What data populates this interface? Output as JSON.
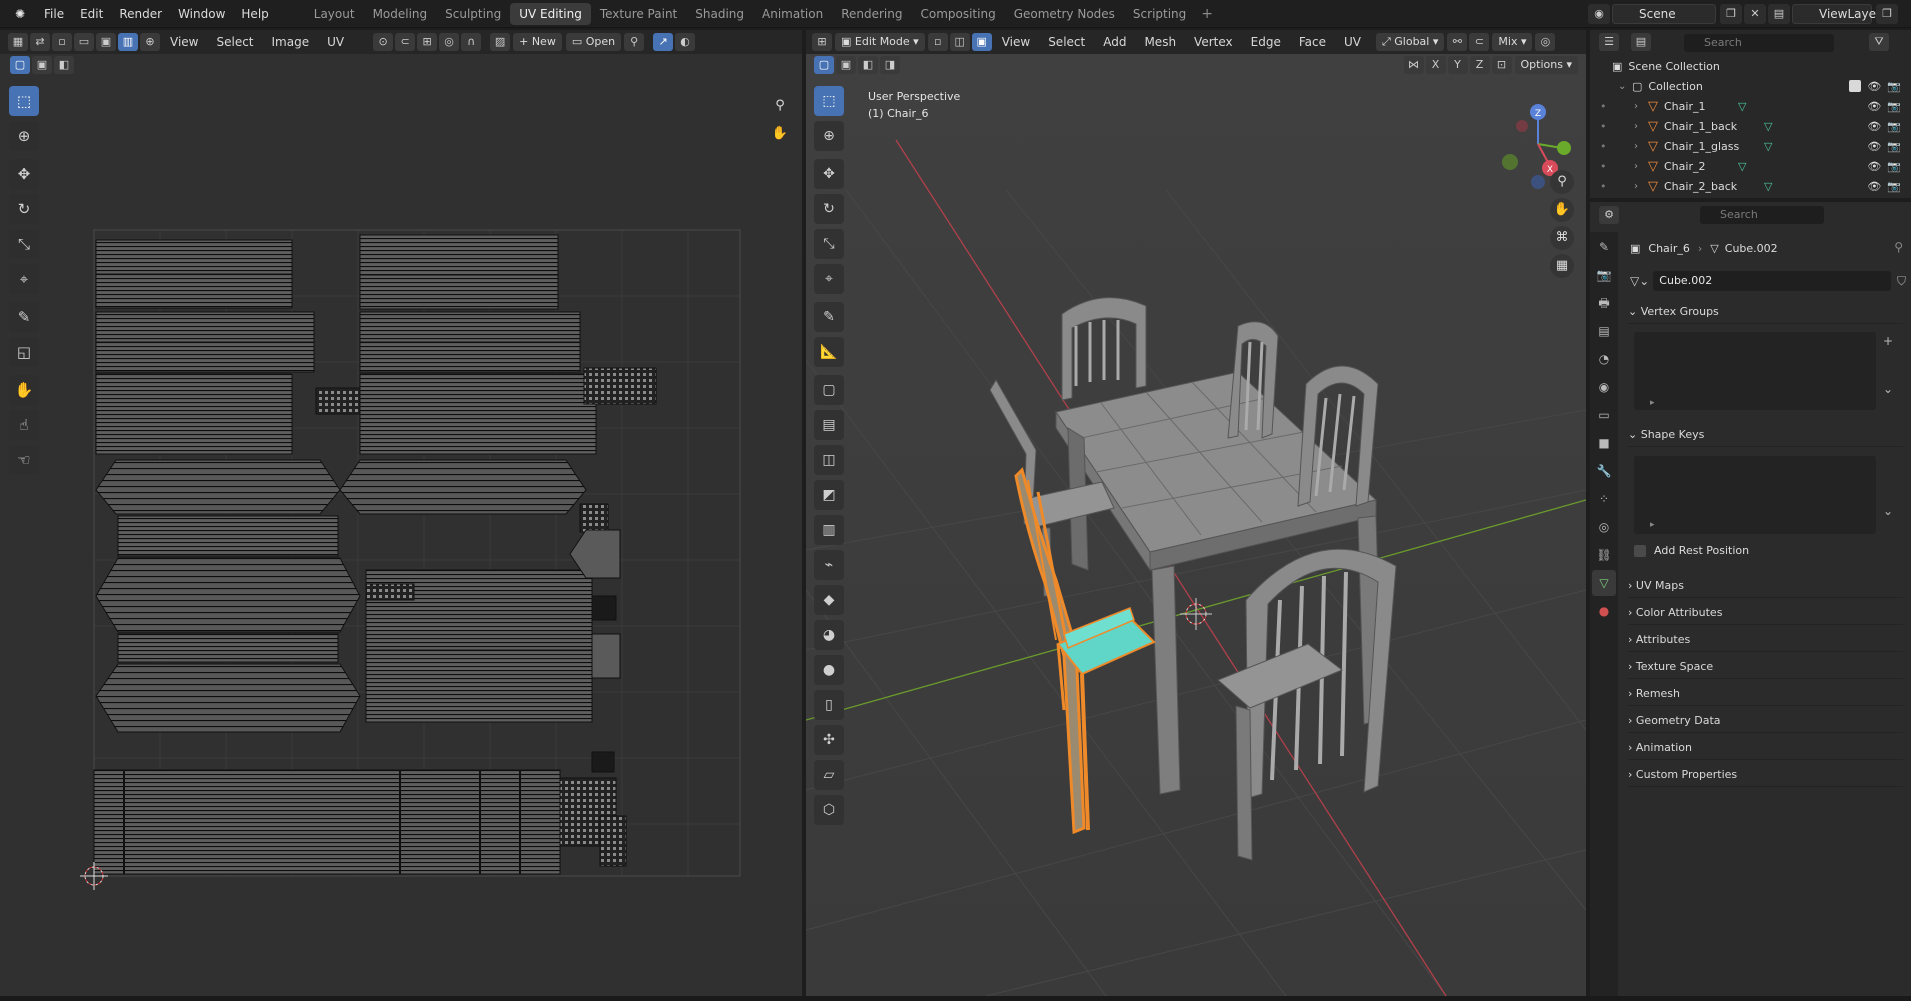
{
  "topbar": {
    "menus": [
      "File",
      "Edit",
      "Render",
      "Window",
      "Help"
    ],
    "workspaces": [
      "Layout",
      "Modeling",
      "Sculpting",
      "UV Editing",
      "Texture Paint",
      "Shading",
      "Animation",
      "Rendering",
      "Compositing",
      "Geometry Nodes",
      "Scripting"
    ],
    "active_workspace": "UV Editing",
    "scene": "Scene",
    "view_layer": "ViewLayer"
  },
  "uv_editor": {
    "header_menus": [
      "View",
      "Select",
      "Image",
      "UV"
    ],
    "new_button": "New",
    "open_button": "Open",
    "tool_icons": [
      "select-box",
      "cursor",
      "move",
      "rotate",
      "scale",
      "transform",
      "annotate",
      "rip",
      "grab",
      "relax",
      "pinch"
    ]
  },
  "viewport": {
    "mode": "Edit Mode",
    "header_menus": [
      "View",
      "Select",
      "Add",
      "Mesh",
      "Vertex",
      "Edge",
      "Face",
      "UV"
    ],
    "orientation": "Global",
    "shading_blend": "Mix",
    "options_label": "Options",
    "axis_labels": [
      "X",
      "Y",
      "Z"
    ],
    "view_name": "User Perspective",
    "object_name": "(1) Chair_6"
  },
  "outliner": {
    "search_placeholder": "Search",
    "root": "Scene Collection",
    "collection": "Collection",
    "items": [
      "Chair_1",
      "Chair_1_back",
      "Chair_1_glass",
      "Chair_2",
      "Chair_2_back"
    ]
  },
  "properties": {
    "search_placeholder": "Search",
    "breadcrumb_object": "Chair_6",
    "breadcrumb_mesh": "Cube.002",
    "mesh_name": "Cube.002",
    "vertex_groups": "Vertex Groups",
    "shape_keys": "Shape Keys",
    "add_rest_position": "Add Rest Position",
    "sections": [
      "UV Maps",
      "Color Attributes",
      "Attributes",
      "Texture Space",
      "Remesh",
      "Geometry Data",
      "Animation",
      "Custom Properties"
    ]
  },
  "colors": {
    "selection_orange": "#ee8a2a",
    "selected_face_cyan": "#5fd6c8",
    "active_blue": "#4772b3",
    "mesh_data_green": "#4ec9a0"
  }
}
